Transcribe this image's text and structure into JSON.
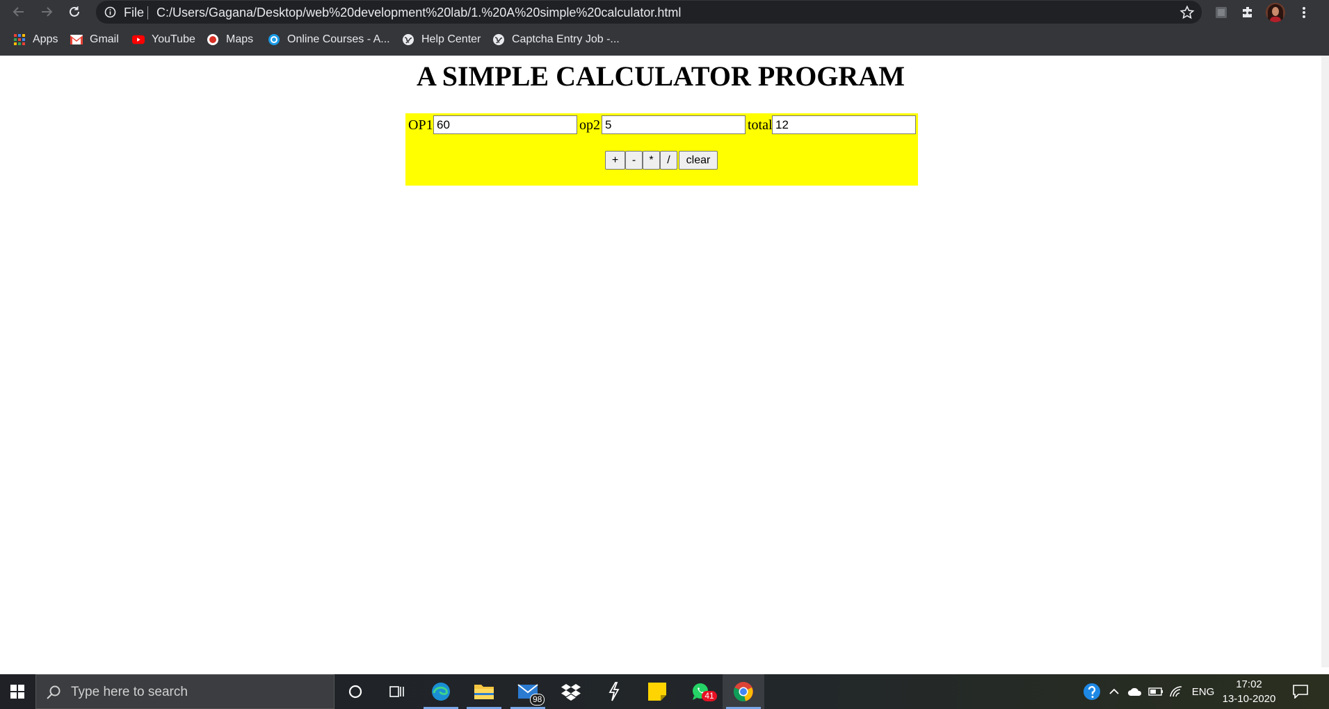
{
  "browser": {
    "omnibox_scheme": "File",
    "url": "C:/Users/Gagana/Desktop/web%20development%20lab/1.%20A%20simple%20calculator.html"
  },
  "bookmarks": [
    {
      "label": "Apps",
      "icon": "apps-grid-icon"
    },
    {
      "label": "Gmail",
      "icon": "gmail-icon"
    },
    {
      "label": "YouTube",
      "icon": "youtube-icon"
    },
    {
      "label": "Maps",
      "icon": "maps-icon"
    },
    {
      "label": "Online Courses - A...",
      "icon": "course-icon"
    },
    {
      "label": "Help Center",
      "icon": "globe-icon"
    },
    {
      "label": "Captcha Entry Job -...",
      "icon": "globe-icon"
    }
  ],
  "page": {
    "title": "A SIMPLE CALCULATOR PROGRAM",
    "background_color": "#ffff00",
    "fields": [
      {
        "label": "OP1",
        "value": "60"
      },
      {
        "label": "op2",
        "value": "5"
      },
      {
        "label": "total",
        "value": "12"
      }
    ],
    "buttons": [
      "+",
      "-",
      "*",
      "/",
      "clear"
    ]
  },
  "taskbar": {
    "search_placeholder": "Type here to search",
    "mail_badge": "98",
    "whatsapp_badge": "41",
    "language": "ENG",
    "time": "17:02",
    "date": "13-10-2020"
  }
}
